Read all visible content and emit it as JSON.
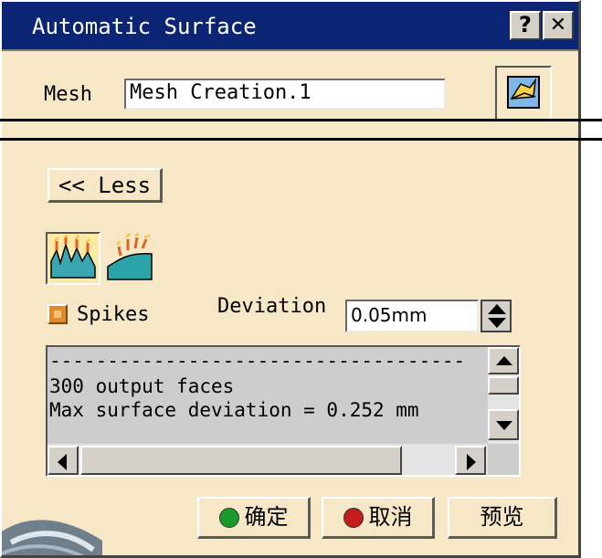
{
  "dialog": {
    "title": "Automatic Surface",
    "help_button": "?",
    "close_button": "✕"
  },
  "mesh": {
    "label": "Mesh",
    "value": "Mesh Creation.1"
  },
  "less_button": "<< Less",
  "spikes": {
    "label": "Spikes"
  },
  "deviation": {
    "label": "Deviation",
    "value": "0.05mm"
  },
  "log": {
    "lines": [
      "------------------------------------",
      "300 output faces",
      "Max surface deviation = 0.252 mm"
    ]
  },
  "buttons": {
    "ok": "确定",
    "cancel": "取消",
    "preview": "预览"
  },
  "colors": {
    "dialog_bg": "#f6e8c7",
    "titlebar": "#0b2473",
    "ok_dot": "#1a9a2a",
    "cancel_dot": "#c21c1c"
  }
}
